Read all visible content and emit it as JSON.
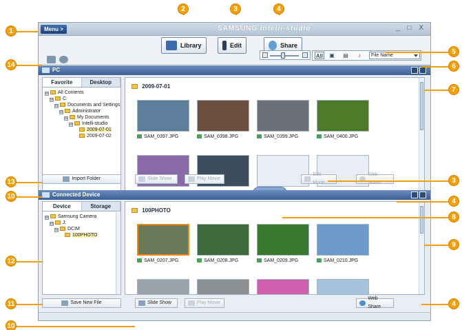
{
  "app": {
    "menu_label": "Menu >",
    "brand_samsung": "SAMSUNG",
    "brand_product": "Intelli-studio",
    "window_controls": "_ □ X"
  },
  "toolbar": {
    "library_label": "Library",
    "edit_label": "Edit",
    "share_label": "Share"
  },
  "filter": {
    "all_label": "All",
    "sort_value": "File Name"
  },
  "pc_panel": {
    "title": "PC",
    "tabs": [
      "Favorite",
      "Desktop"
    ],
    "tree": [
      {
        "label": "All Contents",
        "indent": 0,
        "box": "⊟"
      },
      {
        "label": "C:",
        "indent": 1,
        "box": "⊟"
      },
      {
        "label": "Documents and Settings",
        "indent": 2,
        "box": "⊟"
      },
      {
        "label": "Administrator",
        "indent": 3,
        "box": "⊟"
      },
      {
        "label": "My Documents",
        "indent": 4,
        "box": "⊟"
      },
      {
        "label": "Intelli-studio",
        "indent": 5,
        "box": "⊟"
      },
      {
        "label": "2009-07-01",
        "indent": 6,
        "box": "",
        "highlight": true
      },
      {
        "label": "2009-07-02",
        "indent": 6,
        "box": ""
      }
    ],
    "folder_title": "2009-07-01",
    "thumbs": [
      {
        "caption": "SAM_0397.JPG",
        "color": "#5d7f9c"
      },
      {
        "caption": "SAM_0398.JPG",
        "color": "#6b4f3c"
      },
      {
        "caption": "SAM_0399.JPG",
        "color": "#6a6f79"
      },
      {
        "caption": "SAM_0400.JPG",
        "color": "#4f7a2a"
      },
      {
        "caption": "",
        "color": "#8a6aa6"
      },
      {
        "caption": "",
        "color": "#3c4d5e"
      },
      {
        "caption": "",
        "color": "#e9eef4"
      },
      {
        "caption": "",
        "color": "#e9eef4"
      }
    ],
    "import_label": "Import Folder",
    "slideshow_label": "Slide Show",
    "playmovie_label": "Play Movie",
    "editmode_label": "Edit Mode",
    "webshare_label": "Web Share"
  },
  "device_panel": {
    "title": "Connected Device",
    "tabs": [
      "Device",
      "Storage"
    ],
    "tree": [
      {
        "label": "Samsung Camera",
        "indent": 0,
        "box": "⊟"
      },
      {
        "label": "J:",
        "indent": 1,
        "box": "⊟"
      },
      {
        "label": "DCIM",
        "indent": 2,
        "box": "⊟"
      },
      {
        "label": "100PHOTO",
        "indent": 3,
        "box": "",
        "highlight": true
      }
    ],
    "folder_title": "100PHOTO",
    "thumbs": [
      {
        "caption": "SAM_0207.JPG",
        "color": "#6b7a5a",
        "selected": true
      },
      {
        "caption": "SAM_0208.JPG",
        "color": "#3f6a3a"
      },
      {
        "caption": "SAM_0209.JPG",
        "color": "#3b7a2e"
      },
      {
        "caption": "SAM_0210.JPG",
        "color": "#6c9bc9"
      },
      {
        "caption": "",
        "color": "#9aa3a8"
      },
      {
        "caption": "",
        "color": "#8c8f92"
      },
      {
        "caption": "",
        "color": "#d05fae"
      },
      {
        "caption": "",
        "color": "#a6c3de"
      }
    ],
    "save_label": "Save New File",
    "slideshow_label": "Slide Show",
    "playmovie_label": "Play Movie",
    "webshare_label": "Web Share"
  },
  "callouts": [
    "1",
    "2",
    "3",
    "4",
    "5",
    "6",
    "7",
    "3",
    "4",
    "8",
    "9",
    "4",
    "10",
    "11",
    "12",
    "13",
    "14",
    "10"
  ],
  "colors": {
    "accent": "#f5a00a",
    "panel_header": "#4a6ca3",
    "selection": "#f08a13"
  }
}
